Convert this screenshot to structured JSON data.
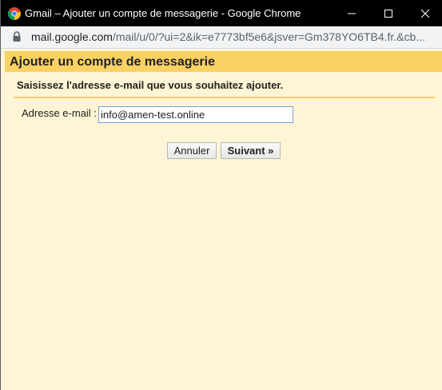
{
  "window": {
    "title": "Gmail – Ajouter un compte de messagerie - Google Chrome",
    "app_icon": "chrome-icon",
    "controls": {
      "minimize": "minimize-icon",
      "maximize": "maximize-icon",
      "close": "close-icon"
    }
  },
  "addressbar": {
    "lock_icon": "lock-icon",
    "url_host": "mail.google.com",
    "url_rest": "/mail/u/0/?ui=2&ik=e7773bf5e6&jsver=Gm378YO6TB4.fr.&cb..."
  },
  "dialog": {
    "title": "Ajouter un compte de messagerie",
    "instruction": "Saisissez l'adresse e-mail que vous souhaitez ajouter.",
    "email_label": "Adresse e-mail :",
    "email_value": "info@amen-test.online",
    "cancel_label": "Annuler",
    "next_label": "Suivant »"
  },
  "colors": {
    "header": "#fad163",
    "body": "#fdf5d5",
    "titlebar": "#000000"
  }
}
